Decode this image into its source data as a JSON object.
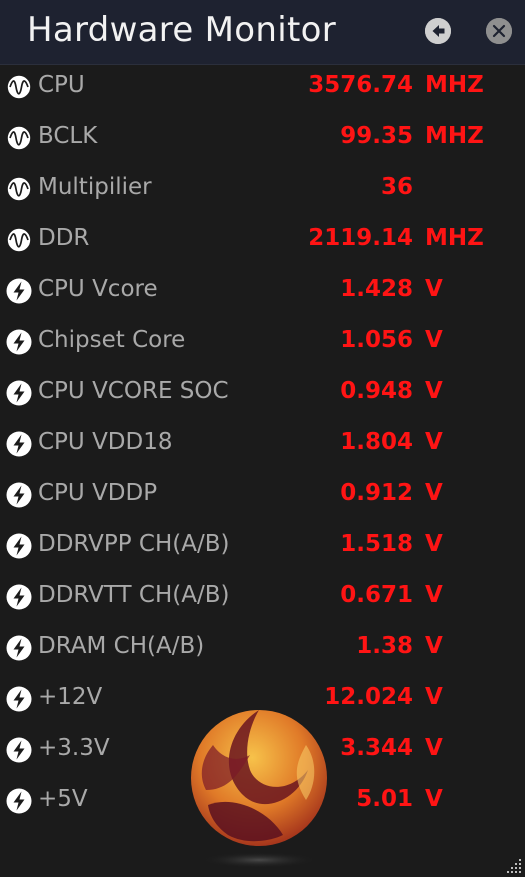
{
  "window": {
    "title": "Hardware Monitor"
  },
  "icons": {
    "back": "back-arrow-icon",
    "close": "close-icon",
    "clock": "waveform-icon",
    "voltage": "lightning-icon",
    "resize": "resize-grip-icon"
  },
  "colors": {
    "value": "#ff1414",
    "label": "#a9a9a9",
    "titlebar": "#1e2230",
    "background": "#1b1b1b"
  },
  "rows": [
    {
      "label": "CPU",
      "value": "3576.74",
      "unit": "MHZ",
      "icon": "waveform-icon"
    },
    {
      "label": "BCLK",
      "value": "99.35",
      "unit": "MHZ",
      "icon": "waveform-icon"
    },
    {
      "label": "Multipilier",
      "value": "36",
      "unit": "",
      "icon": "waveform-icon"
    },
    {
      "label": "DDR",
      "value": "2119.14",
      "unit": "MHZ",
      "icon": "waveform-icon"
    },
    {
      "label": "CPU Vcore",
      "value": "1.428",
      "unit": "V",
      "icon": "lightning-icon"
    },
    {
      "label": "Chipset Core",
      "value": "1.056",
      "unit": "V",
      "icon": "lightning-icon"
    },
    {
      "label": "CPU VCORE SOC",
      "value": "0.948",
      "unit": "V",
      "icon": "lightning-icon"
    },
    {
      "label": "CPU VDD18",
      "value": "1.804",
      "unit": "V",
      "icon": "lightning-icon"
    },
    {
      "label": "CPU VDDP",
      "value": "0.912",
      "unit": "V",
      "icon": "lightning-icon"
    },
    {
      "label": "DDRVPP CH(A/B)",
      "value": "1.518",
      "unit": "V",
      "icon": "lightning-icon"
    },
    {
      "label": "DDRVTT CH(A/B)",
      "value": "0.671",
      "unit": "V",
      "icon": "lightning-icon"
    },
    {
      "label": "DRAM CH(A/B)",
      "value": "1.38",
      "unit": "V",
      "icon": "lightning-icon"
    },
    {
      "label": "+12V",
      "value": "12.024",
      "unit": "V",
      "icon": "lightning-icon"
    },
    {
      "label": "+3.3V",
      "value": "3.344",
      "unit": "V",
      "icon": "lightning-icon"
    },
    {
      "label": "+5V",
      "value": "5.01",
      "unit": "V",
      "icon": "lightning-icon"
    }
  ]
}
